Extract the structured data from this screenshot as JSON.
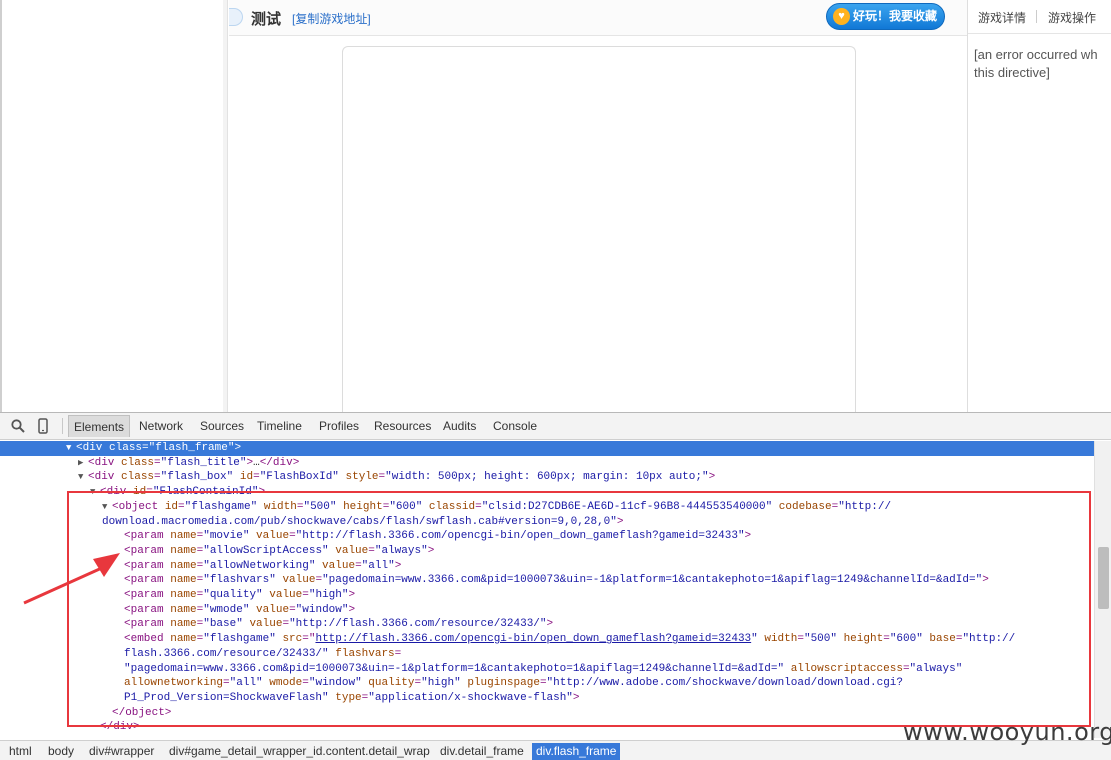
{
  "page": {
    "game_title": "测试",
    "copy_link": "[复制游戏地址]",
    "fav_button": "好玩！我要收藏",
    "right_tabs": [
      "游戏详情",
      "游戏操作"
    ],
    "error_line1": "[an error occurred wh",
    "error_line2": "this directive]"
  },
  "devtools": {
    "tabs": [
      "Elements",
      "Network",
      "Sources",
      "Timeline",
      "Profiles",
      "Resources",
      "Audits",
      "Console"
    ],
    "active_tab": "Elements",
    "lines": [
      {
        "t": "▼",
        "tg1": "<div ",
        "an1": "class",
        "eq1": "=",
        "av1": "\"flash_frame\"",
        "tg2": ">"
      },
      {
        "t": "▶",
        "tg1": "<div ",
        "an1": "class",
        "eq1": "=",
        "av1": "\"flash_title\"",
        "tg2": ">",
        "tx": "…",
        "tg3": "</div>"
      },
      {
        "t": "▼",
        "tg1": "<div ",
        "an1": "class",
        "eq1": "=",
        "av1": "\"flash_box\"",
        "an2": " id",
        "eq2": "=",
        "av2": "\"FlashBoxId\"",
        "an3": " style",
        "eq3": "=",
        "av3": "\"width: 500px; height: 600px; margin: 10px auto;\"",
        "tg2": ">"
      },
      {
        "t": "▼",
        "tg1": "<div ",
        "an1": "id",
        "eq1": "=",
        "av1": "\"FlashContainId\"",
        "tg2": ">"
      },
      {
        "t": "▼",
        "tg1": "<object ",
        "an1": "id",
        "eq1": "=",
        "av1": "\"flashgame\"",
        "an2": " width",
        "eq2": "=",
        "av2": "\"500\"",
        "an3": " height",
        "eq3": "=",
        "av3": "\"600\"",
        "an4": " classid",
        "eq4": "=",
        "av4": "\"clsid:D27CDB6E-AE6D-11cf-96B8-444553540000\"",
        "an5": " codebase",
        "eq5": "=",
        "av5": "\"http://"
      },
      {
        "av1": "download.macromedia.com/pub/shockwave/cabs/flash/swflash.cab#version=9,0,28,0\"",
        "tg2": ">"
      },
      {
        "tg1": "<param ",
        "an1": "name",
        "eq1": "=",
        "av1": "\"movie\"",
        "an2": " value",
        "eq2": "=",
        "av2": "\"http://flash.3366.com/opencgi-bin/open_down_gameflash?gameid=32433\"",
        "tg2": ">"
      },
      {
        "tg1": "<param ",
        "an1": "name",
        "eq1": "=",
        "av1": "\"allowScriptAccess\"",
        "an2": " value",
        "eq2": "=",
        "av2": "\"always\"",
        "tg2": ">"
      },
      {
        "tg1": "<param ",
        "an1": "name",
        "eq1": "=",
        "av1": "\"allowNetworking\"",
        "an2": " value",
        "eq2": "=",
        "av2": "\"all\"",
        "tg2": ">"
      },
      {
        "tg1": "<param ",
        "an1": "name",
        "eq1": "=",
        "av1": "\"flashvars\"",
        "an2": " value",
        "eq2": "=",
        "av2": "\"pagedomain=www.3366.com&pid=1000073&uin=-1&platform=1&cantakephoto=1&apiflag=1249&channelId=&adId=\"",
        "tg2": ">"
      },
      {
        "tg1": "<param ",
        "an1": "name",
        "eq1": "=",
        "av1": "\"quality\"",
        "an2": " value",
        "eq2": "=",
        "av2": "\"high\"",
        "tg2": ">"
      },
      {
        "tg1": "<param ",
        "an1": "name",
        "eq1": "=",
        "av1": "\"wmode\"",
        "an2": " value",
        "eq2": "=",
        "av2": "\"window\"",
        "tg2": ">"
      },
      {
        "tg1": "<param ",
        "an1": "name",
        "eq1": "=",
        "av1": "\"base\"",
        "an2": " value",
        "eq2": "=",
        "av2": "\"http://flash.3366.com/resource/32433/\"",
        "tg2": ">"
      },
      {
        "tg1": "<embed ",
        "an1": "name",
        "eq1": "=",
        "av1": "\"flashgame\"",
        "an2": " src",
        "eq2": "=\"",
        "lk": "http://flash.3366.com/opencgi-bin/open_down_gameflash?gameid=32433",
        "av2": "\"",
        "an3": " width",
        "eq3": "=",
        "av3": "\"500\"",
        "an4": " height",
        "eq4": "=",
        "av4": "\"600\"",
        "an5": " base",
        "eq5": "=",
        "av5": "\"http://"
      },
      {
        "av1": "flash.3366.com/resource/32433/\"",
        "an2": " flashvars",
        "eq2": "="
      },
      {
        "av1": "\"pagedomain=www.3366.com&pid=1000073&uin=-1&platform=1&cantakephoto=1&apiflag=1249&channelId=&adId=\"",
        "an2": " allowscriptaccess",
        "eq2": "=",
        "av2": "\"always\""
      },
      {
        "an1": "allownetworking",
        "eq1": "=",
        "av1": "\"all\"",
        "an2": " wmode",
        "eq2": "=",
        "av2": "\"window\"",
        "an3": " quality",
        "eq3": "=",
        "av3": "\"high\"",
        "an4": " pluginspage",
        "eq4": "=",
        "av4": "\"http://www.adobe.com/shockwave/download/download.cgi?"
      },
      {
        "av1": "P1_Prod_Version=ShockwaveFlash\"",
        "an2": " type",
        "eq2": "=",
        "av2": "\"application/x-shockwave-flash\"",
        "tg2": ">"
      },
      {
        "tg1": "</object>"
      },
      {
        "tg1": "</div>"
      }
    ],
    "breadcrumbs": [
      "html",
      "body",
      "div#wrapper",
      "div#game_detail_wrapper_id.content.detail_wrap",
      "div.detail_frame",
      "div.flash_frame"
    ]
  },
  "watermark": "www.wooyun.org",
  "colors": {
    "selection": "#3879d9",
    "highlight": "#e8373d",
    "fav_button": "#1a86de"
  }
}
